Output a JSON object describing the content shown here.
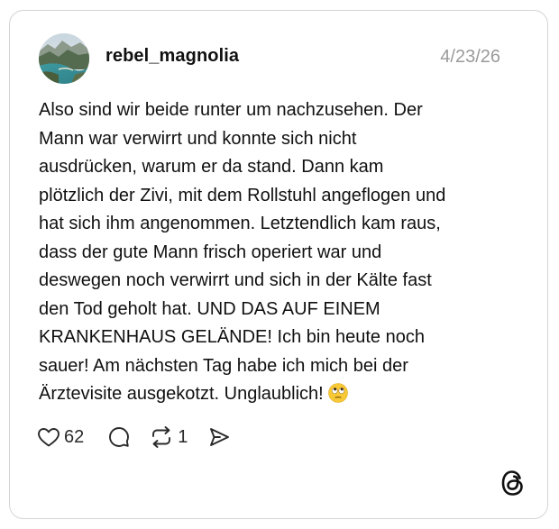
{
  "post": {
    "username": "rebel_magnolia",
    "date": "4/23/26",
    "text_lines": [
      "Also sind wir beide runter um nachzusehen. Der",
      "Mann war verwirrt und konnte sich nicht",
      "ausdrücken, warum er da stand. Dann kam",
      "plötzlich der Zivi, mit dem Rollstuhl angeflogen und",
      "hat sich ihm angenommen. Letztendlich kam raus,",
      "dass der gute Mann frisch operiert war und",
      "deswegen noch verwirrt und sich in der Kälte fast",
      "den Tod geholt hat. UND DAS AUF EINEM",
      "KRANKENHAUS GELÄNDE! Ich bin heute noch",
      "sauer! Am nächsten Tag habe ich mich bei der",
      "Ärztevisite  ausgekotzt. Unglaublich!"
    ],
    "trailing_emoji": "face-with-rolling-eyes"
  },
  "actions": {
    "like_icon": "heart-icon",
    "like_count": "62",
    "comment_icon": "comment-icon",
    "repost_icon": "repost-icon",
    "repost_count": "1",
    "share_icon": "share-icon"
  },
  "branding": {
    "logo": "threads-logo-icon"
  },
  "colors": {
    "border": "#d4d4d4",
    "text": "#101010",
    "date": "#9a9a9a"
  }
}
